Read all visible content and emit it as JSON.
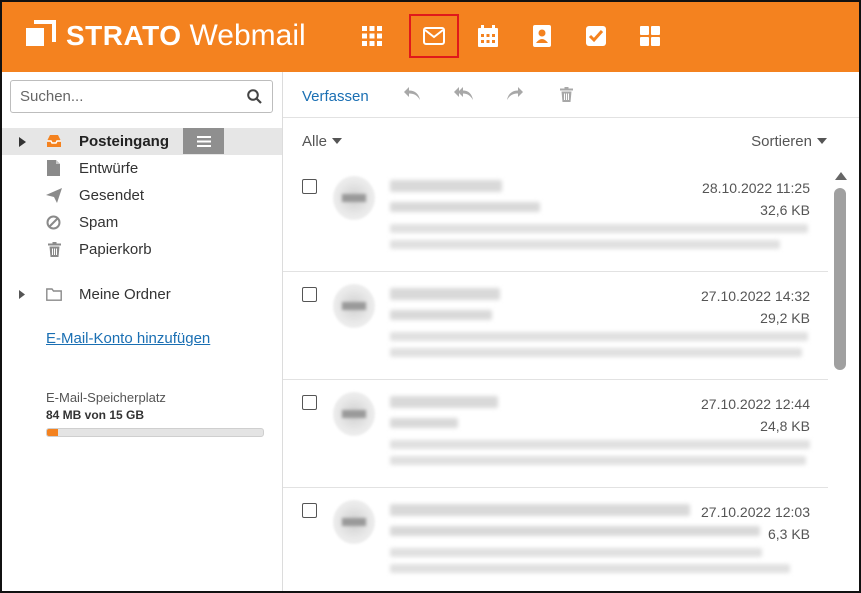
{
  "header": {
    "brand": "STRATO",
    "product": "Webmail",
    "apps": [
      {
        "name": "apps-grid-icon",
        "active": false
      },
      {
        "name": "mail-icon",
        "active": true
      },
      {
        "name": "calendar-icon",
        "active": false
      },
      {
        "name": "contacts-icon",
        "active": false
      },
      {
        "name": "tasks-icon",
        "active": false
      },
      {
        "name": "dashboard-icon",
        "active": false
      }
    ],
    "colors": {
      "background": "#f4821f",
      "active_outline": "#e0191b"
    }
  },
  "sidebar": {
    "search_placeholder": "Suchen...",
    "folders": [
      {
        "label": "Posteingang",
        "icon": "inbox-icon",
        "selected": true
      },
      {
        "label": "Entwürfe",
        "icon": "draft-icon",
        "selected": false
      },
      {
        "label": "Gesendet",
        "icon": "sent-icon",
        "selected": false
      },
      {
        "label": "Spam",
        "icon": "spam-icon",
        "selected": false
      },
      {
        "label": "Papierkorb",
        "icon": "trash-icon",
        "selected": false
      }
    ],
    "my_folders_label": "Meine Ordner",
    "add_account_label": "E-Mail-Konto hinzufügen",
    "storage": {
      "label": "E-Mail-Speicherplatz",
      "value": "84 MB von 15 GB",
      "fraction_used": 0.0055
    }
  },
  "toolbar": {
    "compose_label": "Verfassen",
    "icons": [
      "reply-icon",
      "reply-all-icon",
      "forward-icon",
      "delete-icon"
    ]
  },
  "list": {
    "filter_label": "Alle",
    "sort_label": "Sortieren",
    "messages": [
      {
        "date": "28.10.2022 11:25",
        "size": "32,6 KB"
      },
      {
        "date": "27.10.2022 14:32",
        "size": "29,2 KB"
      },
      {
        "date": "27.10.2022 12:44",
        "size": "24,8 KB"
      },
      {
        "date": "27.10.2022 12:03",
        "size": "6,3 KB"
      }
    ]
  }
}
